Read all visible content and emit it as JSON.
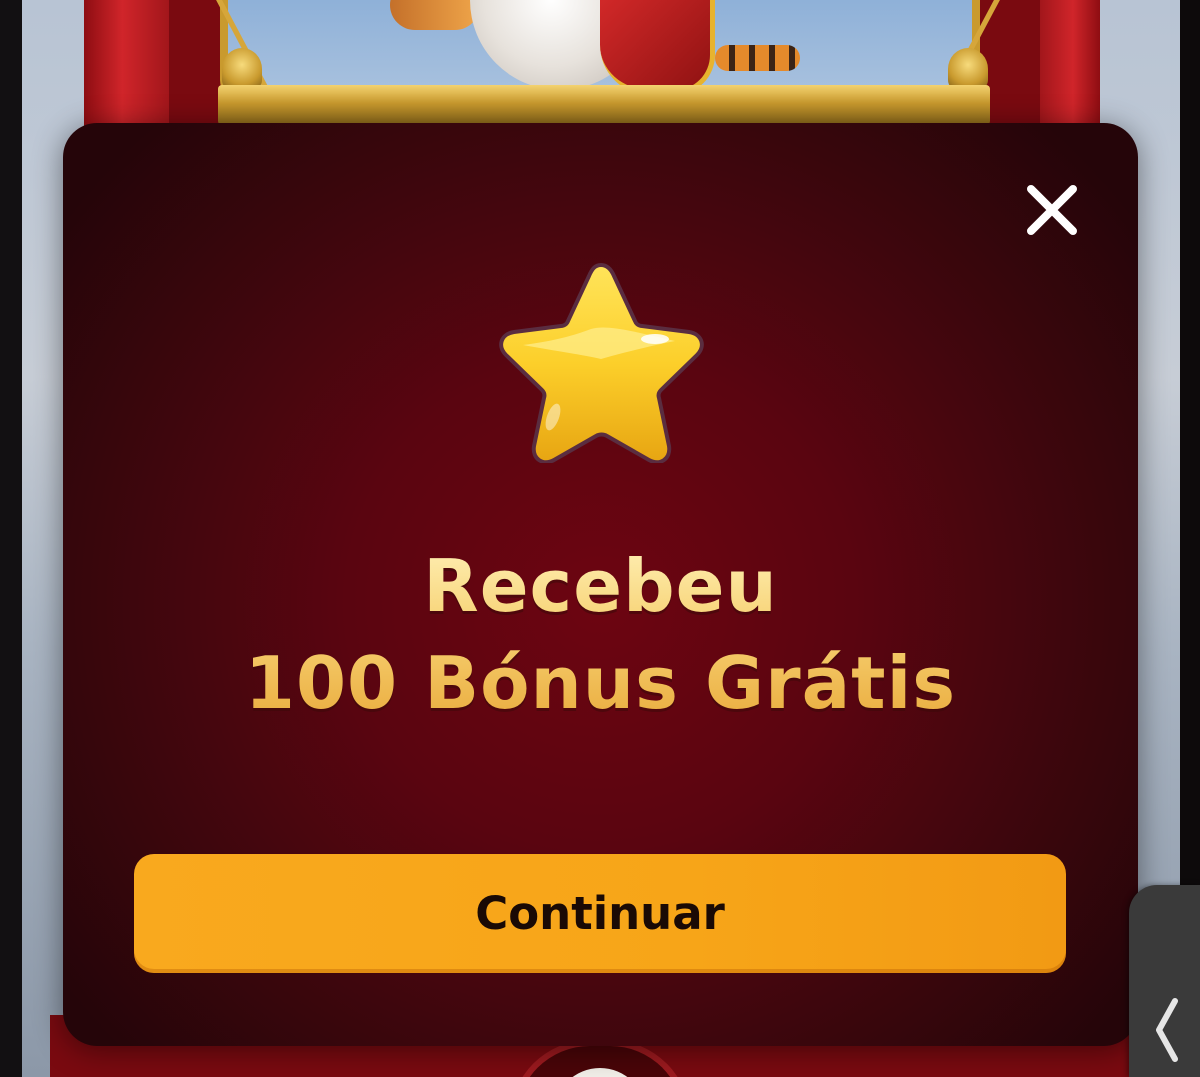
{
  "dialog": {
    "title_line_1": "Recebeu",
    "title_line_2": "100 Bónus Grátis",
    "continue_label": "Continuar",
    "close_icon": "close-icon",
    "reward_icon": "star-icon"
  },
  "side_tab": {
    "icon": "chevron-left-icon"
  },
  "colors": {
    "modal_background": "#5a0510",
    "title_gold": "#f6cd6a",
    "button_orange": "#f9a91e",
    "button_text": "#1a0a05",
    "star_yellow": "#fccf2a"
  }
}
